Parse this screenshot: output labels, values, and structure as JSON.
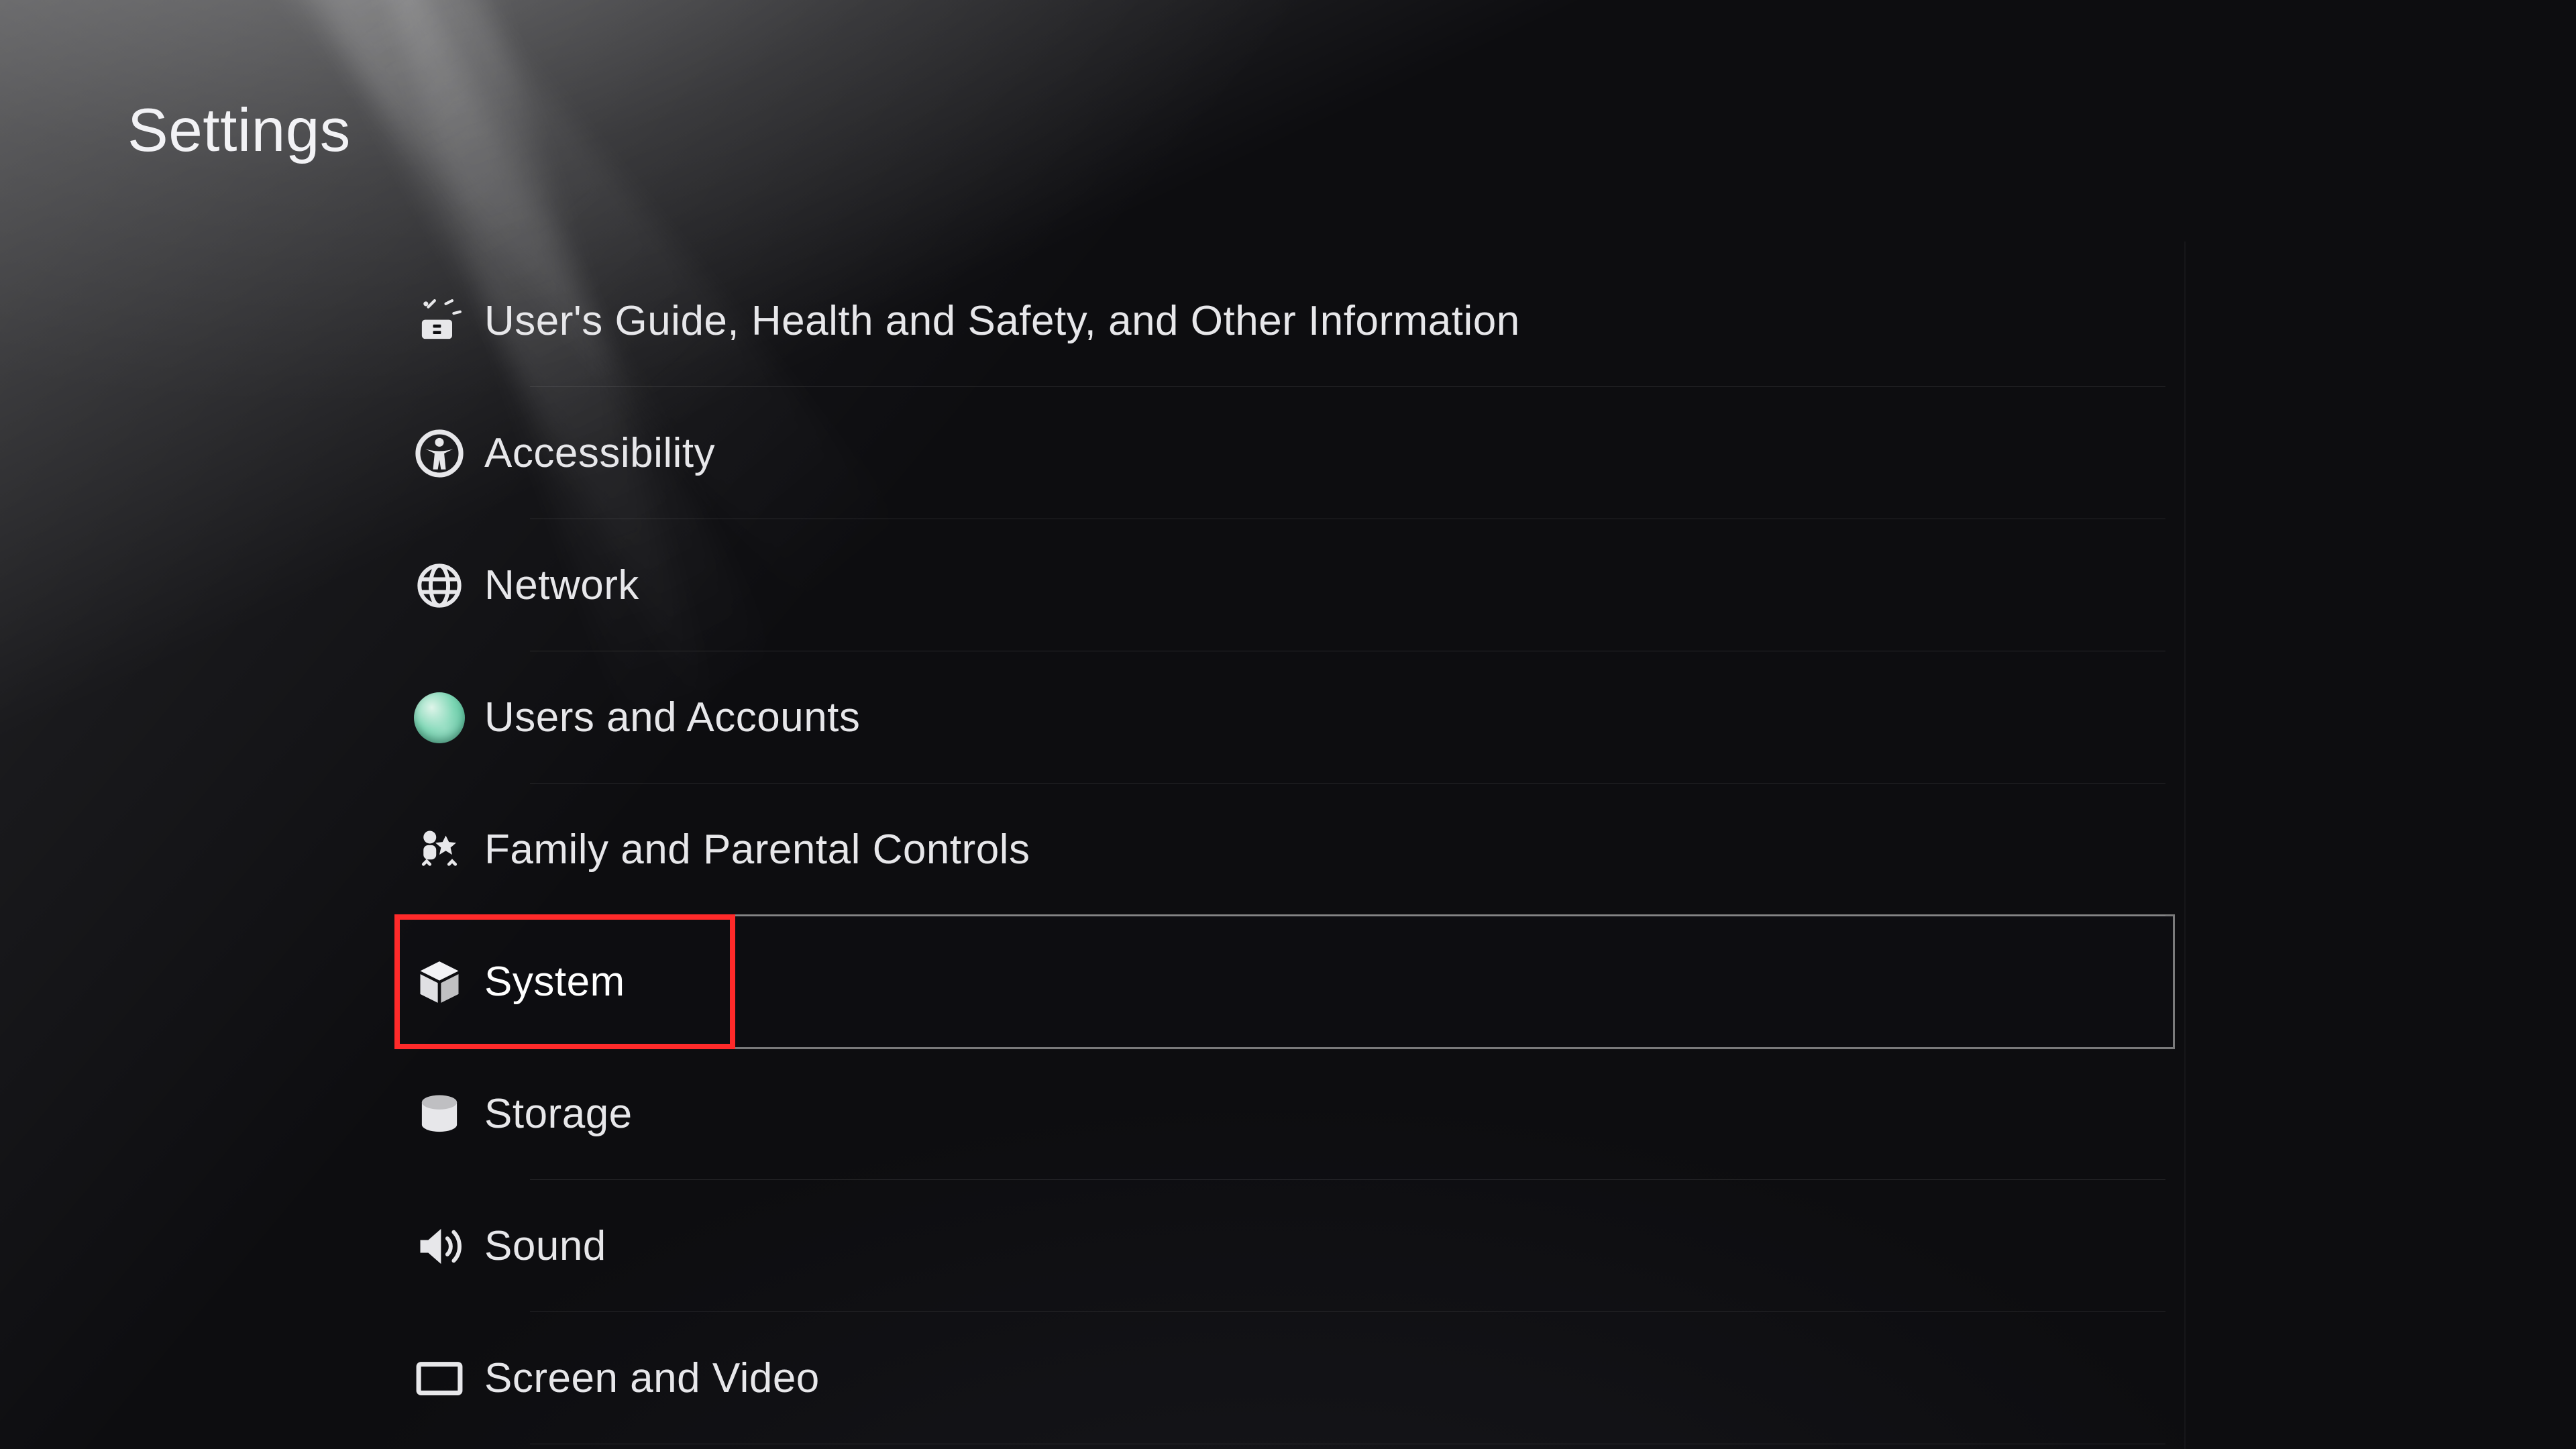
{
  "page": {
    "title": "Settings"
  },
  "menu": {
    "selected_index": 5,
    "items": [
      {
        "id": "users-guide",
        "label": "User's Guide, Health and Safety, and Other Information",
        "icon": "info-kit-icon"
      },
      {
        "id": "accessibility",
        "label": "Accessibility",
        "icon": "accessibility-icon"
      },
      {
        "id": "network",
        "label": "Network",
        "icon": "globe-icon"
      },
      {
        "id": "users-accounts",
        "label": "Users and Accounts",
        "icon": "avatar-icon"
      },
      {
        "id": "family-parental",
        "label": "Family and Parental Controls",
        "icon": "family-icon"
      },
      {
        "id": "system",
        "label": "System",
        "icon": "cube-icon"
      },
      {
        "id": "storage",
        "label": "Storage",
        "icon": "storage-icon"
      },
      {
        "id": "sound",
        "label": "Sound",
        "icon": "speaker-icon"
      },
      {
        "id": "screen-video",
        "label": "Screen and Video",
        "icon": "screen-icon"
      }
    ]
  },
  "annotation": {
    "highlight_item_id": "system",
    "highlight_color": "#ff2a2a"
  }
}
